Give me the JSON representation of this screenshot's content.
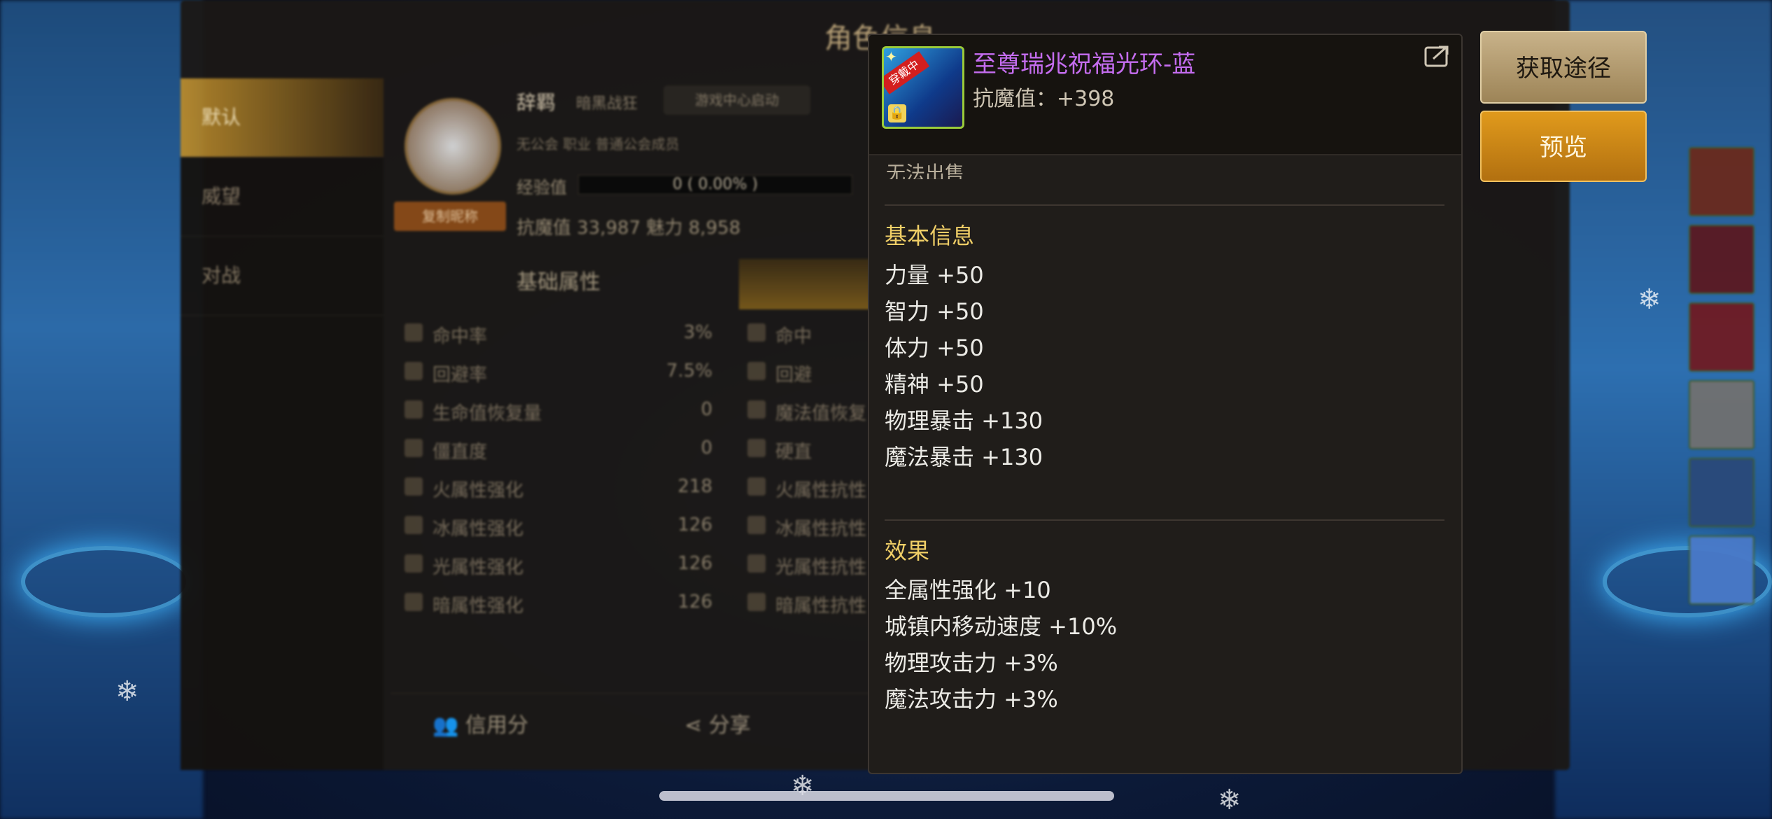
{
  "background_panel": {
    "title": "角色信息",
    "sidebar": [
      "默认",
      "威望",
      "对战"
    ],
    "character": {
      "name": "辞羁",
      "class": "暗黑战狂",
      "launch": "游戏中心启动",
      "guild": "无公会  职业  普通公会成员",
      "copy_button": "复制昵称",
      "exp_label": "经验值",
      "exp_value": "0 ( 0.00% )",
      "stats_line": "抗魔值  33,987   魅力  8,958"
    },
    "tabs": {
      "basic": "基础属性"
    },
    "stats": [
      {
        "name": "命中率",
        "value": "3%",
        "name2": "命中"
      },
      {
        "name": "回避率",
        "value": "7.5%",
        "name2": "回避"
      },
      {
        "name": "生命值恢复量",
        "value": "0",
        "name2": "魔法值恢复"
      },
      {
        "name": "僵直度",
        "value": "0",
        "name2": "硬直"
      },
      {
        "name": "火属性强化",
        "value": "218",
        "name2": "火属性抗性"
      },
      {
        "name": "冰属性强化",
        "value": "126",
        "name2": "冰属性抗性"
      },
      {
        "name": "光属性强化",
        "value": "126",
        "name2": "光属性抗性"
      },
      {
        "name": "暗属性强化",
        "value": "126",
        "name2": "暗属性抗性"
      }
    ],
    "bottom": {
      "credit": "信用分",
      "share": "分享"
    }
  },
  "tooltip": {
    "item_name": "至尊瑞兆祝福光环-蓝",
    "wear_badge": "穿戴中",
    "stat": "抗魔值：+398",
    "unsellable": "无法出售",
    "basic_title": "基本信息",
    "basic_lines": [
      "力量 +50",
      "智力 +50",
      "体力 +50",
      "精神 +50",
      "物理暴击 +130",
      "魔法暴击 +130"
    ],
    "effect_title": "效果",
    "effect_lines": [
      "全属性强化 +10",
      "城镇内移动速度 +10%",
      "物理攻击力 +3%",
      "魔法攻击力 +3%"
    ]
  },
  "buttons": {
    "get_source": "获取途径",
    "preview": "预览"
  },
  "colors": {
    "item_name": "#c56df0",
    "section_title": "#f0cf67",
    "preview_button": "#e09a1c",
    "get_button": "#c8b289"
  }
}
